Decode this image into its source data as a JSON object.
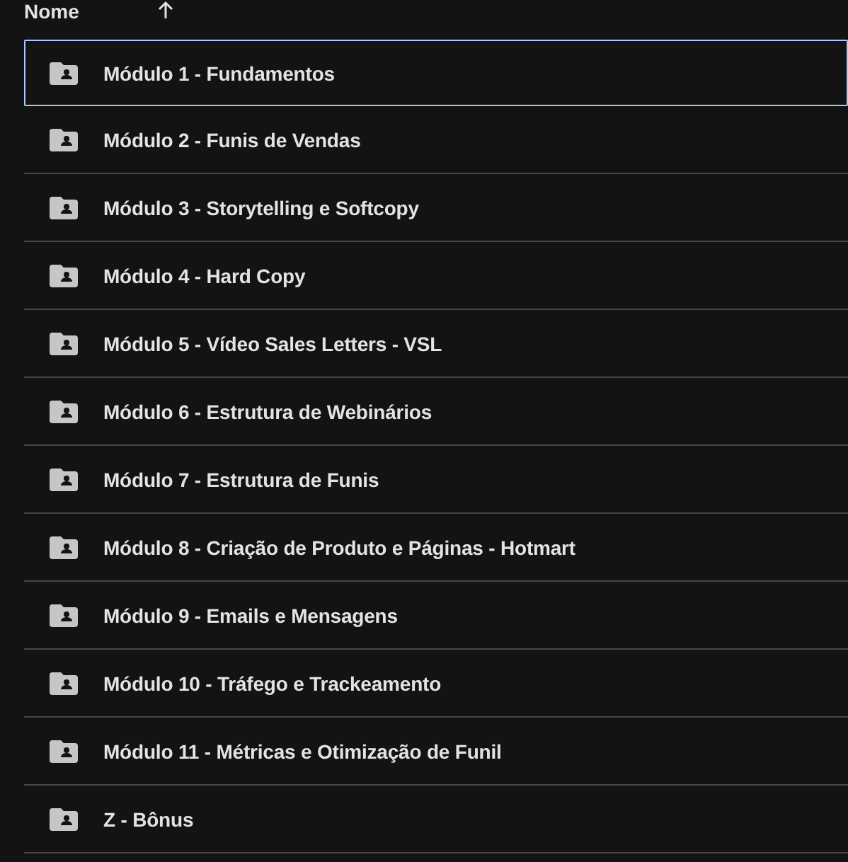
{
  "header": {
    "column": "Nome",
    "sort_ascending": true
  },
  "rows": [
    {
      "name": "Módulo 1 - Fundamentos",
      "selected": true
    },
    {
      "name": "Módulo 2 - Funis de Vendas",
      "selected": false
    },
    {
      "name": "Módulo 3 - Storytelling e Softcopy",
      "selected": false
    },
    {
      "name": "Módulo 4 - Hard Copy",
      "selected": false
    },
    {
      "name": "Módulo 5 - Vídeo Sales Letters - VSL",
      "selected": false
    },
    {
      "name": "Módulo 6 - Estrutura de Webinários",
      "selected": false
    },
    {
      "name": "Módulo 7 - Estrutura de Funis",
      "selected": false
    },
    {
      "name": "Módulo 8 - Criação de Produto e Páginas - Hotmart",
      "selected": false
    },
    {
      "name": "Módulo 9 - Emails e Mensagens",
      "selected": false
    },
    {
      "name": "Módulo 10 - Tráfego e Trackeamento",
      "selected": false
    },
    {
      "name": "Módulo 11 - Métricas e Otimização de Funil",
      "selected": false
    },
    {
      "name": "Z - Bônus",
      "selected": false
    }
  ]
}
